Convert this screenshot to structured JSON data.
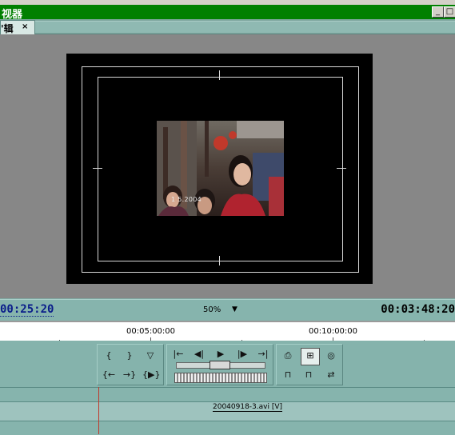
{
  "window": {
    "title": "视器",
    "tab_label": "'辑",
    "tab_close": "×"
  },
  "monitor": {
    "datestamp": "1  5.2004"
  },
  "timecode": {
    "current": "00:25:20",
    "zoom": "50%",
    "duration": "00:03:48:20"
  },
  "ruler": {
    "labels": [
      "00:05:00:00",
      "00:10:00:00"
    ]
  },
  "controls": {
    "mark_in": "{",
    "mark_out": "}",
    "set_marker": "▽",
    "goto_in": "{←",
    "goto_out": "→}",
    "play_in_out": "{▶}",
    "step_back_to_edit": "|←",
    "step_back": "◀|",
    "play": "▶",
    "step_forward": "|▶",
    "step_to_next_edit": "→|",
    "export_frame": "⎙",
    "safe_margins": "⊞",
    "output": "◎",
    "lift": "⊓",
    "extract": "⊓",
    "trim": "⇄"
  },
  "tracks": {
    "clip_name": "20040918-3.avi [V]"
  },
  "colors": {
    "title_bar": "#008000",
    "panel": "#85b3ac",
    "timecode_blue": "#0a1d8a",
    "playhead": "#c0392b"
  }
}
